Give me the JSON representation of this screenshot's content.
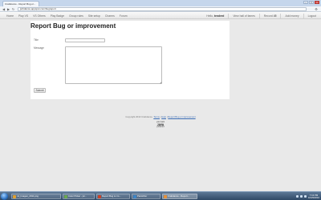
{
  "browser": {
    "tab_title": "Crabdance - Report Bug or...",
    "url": "jsrbdance.appspot.com/bugreport"
  },
  "navbar": {
    "left_items": [
      "Home",
      "Play VS",
      "VS Others",
      "Play Badge",
      "Group rules",
      "Site setup",
      "Charms",
      "Forum"
    ],
    "user_prefix": "Hello,",
    "user_name": "tenderd",
    "right_items": [
      "View hall of fames",
      "Record",
      "Add money",
      "Logout"
    ],
    "record_value": "45"
  },
  "page": {
    "title": "Report Bug or improvement",
    "title_label": "Title",
    "message_label": "Message",
    "title_value": "",
    "message_value": "",
    "submit_label": "Submit"
  },
  "footer": {
    "copyright": "Copyright 2010 Crabdance.",
    "terms": "Terms",
    "help": "Help",
    "report": "Report Bug or improvement",
    "badge_top": "your rank",
    "badge_mid": "JAVA",
    "badge_bot": "powered"
  },
  "taskbar": {
    "tasks": [
      {
        "label": "ml_Imagen_2011.png",
        "color": "#e0a030"
      },
      {
        "label": "Color Picker - jsr...",
        "color": "#6aa84f"
      },
      {
        "label": "Report Bug to rm...",
        "color": "#cc4125"
      },
      {
        "label": "Paint2Ver",
        "color": "#3d85c6"
      },
      {
        "label": "Crabdance - Report...",
        "color": "#e69138"
      }
    ],
    "clock_time": "7:13 PM",
    "clock_date": "10/29/2010"
  }
}
